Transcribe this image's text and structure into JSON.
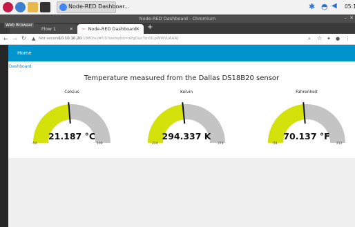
{
  "taskbar": {
    "task_label": "Node-RED Dashboar...",
    "time": "05:1",
    "icons": [
      "raspberry-icon",
      "globe-icon",
      "folder-icon",
      "terminal-icon",
      "chrome-icon"
    ],
    "tray_icons": [
      "bluetooth-icon",
      "wifi-icon",
      "volume-icon"
    ]
  },
  "browser": {
    "window_title": "Node-RED Dashboard - Chromium",
    "tooltip": "Web Browser",
    "tabs": [
      {
        "label": "Flow 1",
        "active": false
      },
      {
        "label": "Node-RED Dashboard",
        "active": true
      }
    ],
    "address": {
      "security": "Not secure",
      "host": "10.10.10.20",
      "path": ":1880/ui/#!/0?socketid=xPgDunTm0lLpWWVuAAAJ"
    }
  },
  "dashboard": {
    "header_title": "Home",
    "group_link": "Dashboard",
    "title": "Temperature measured from the Dallas DS18B20 sensor",
    "colors": {
      "header": "#0094ce",
      "gauge_fill": "#d4e10b",
      "gauge_track": "#c4c4c4",
      "needle": "#111111"
    },
    "gauges": [
      {
        "label": "Celsius",
        "value": 21.187,
        "value_text": "21.187 °C",
        "min": "-50",
        "max": "100",
        "min_num": -50,
        "max_num": 100
      },
      {
        "label": "Kelvin",
        "value": 294.337,
        "value_text": "294.337 K",
        "min": "224",
        "max": "374",
        "min_num": 224,
        "max_num": 374
      },
      {
        "label": "Fahrenheit",
        "value": 70.137,
        "value_text": "70.137 °F",
        "min": "-58",
        "max": "212",
        "min_num": -58,
        "max_num": 212
      }
    ]
  }
}
